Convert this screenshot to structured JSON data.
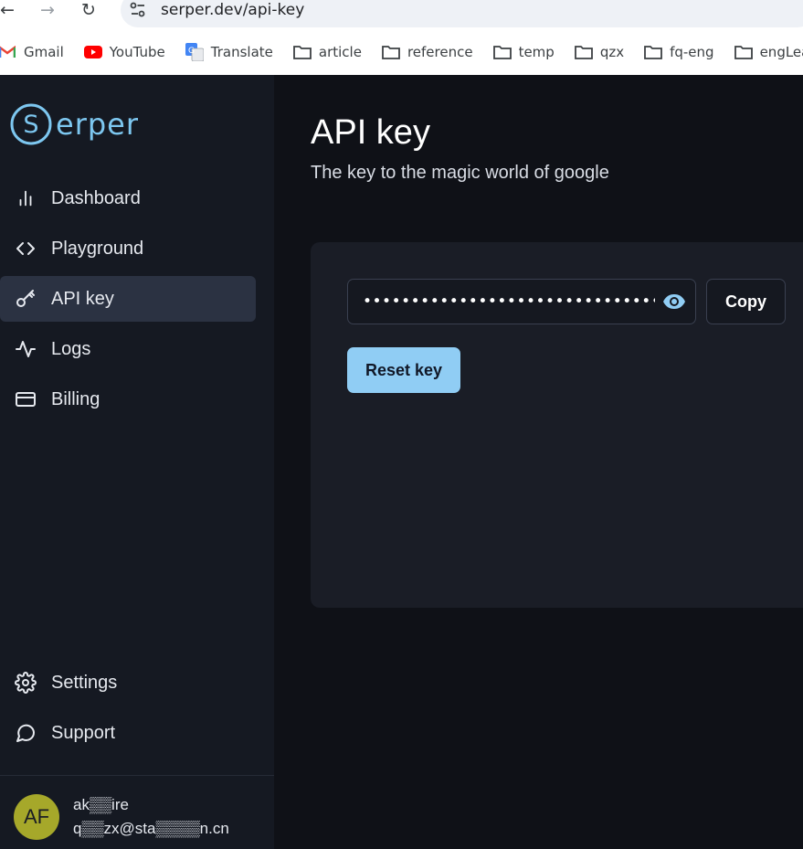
{
  "browser": {
    "url": "serper.dev/api-key",
    "bookmarks": [
      {
        "label": "Gmail",
        "icon": "gmail-icon"
      },
      {
        "label": "YouTube",
        "icon": "youtube-icon"
      },
      {
        "label": "Translate",
        "icon": "translate-icon"
      },
      {
        "label": "article",
        "icon": "folder-icon"
      },
      {
        "label": "reference",
        "icon": "folder-icon"
      },
      {
        "label": "temp",
        "icon": "folder-icon"
      },
      {
        "label": "qzx",
        "icon": "folder-icon"
      },
      {
        "label": "fq-eng",
        "icon": "folder-icon"
      },
      {
        "label": "engLear",
        "icon": "folder-icon"
      }
    ]
  },
  "brand": {
    "logo_letter": "S",
    "logo_text": "erper",
    "accent": "#7dc7f0"
  },
  "sidebar": {
    "items": [
      {
        "label": "Dashboard",
        "icon": "bar-chart-icon"
      },
      {
        "label": "Playground",
        "icon": "code-icon"
      },
      {
        "label": "API key",
        "icon": "key-icon",
        "active": true
      },
      {
        "label": "Logs",
        "icon": "activity-icon"
      },
      {
        "label": "Billing",
        "icon": "credit-card-icon"
      }
    ],
    "bottom_items": [
      {
        "label": "Settings",
        "icon": "gear-icon"
      },
      {
        "label": "Support",
        "icon": "chat-bubble-icon"
      }
    ],
    "user": {
      "initials": "AF",
      "name": "ak▒▒ire",
      "email": "q▒▒zx@sta▒▒▒▒n.cn"
    }
  },
  "main": {
    "title": "API key",
    "subtitle": "The key to the magic world of google",
    "key_masked": "••••••••••••••••••••••••••••••••••••",
    "copy_label": "Copy",
    "reset_label": "Reset key"
  },
  "colors": {
    "reset_button": "#90cdf4",
    "avatar": "#a6a82a",
    "active_nav": "#2b3242"
  }
}
